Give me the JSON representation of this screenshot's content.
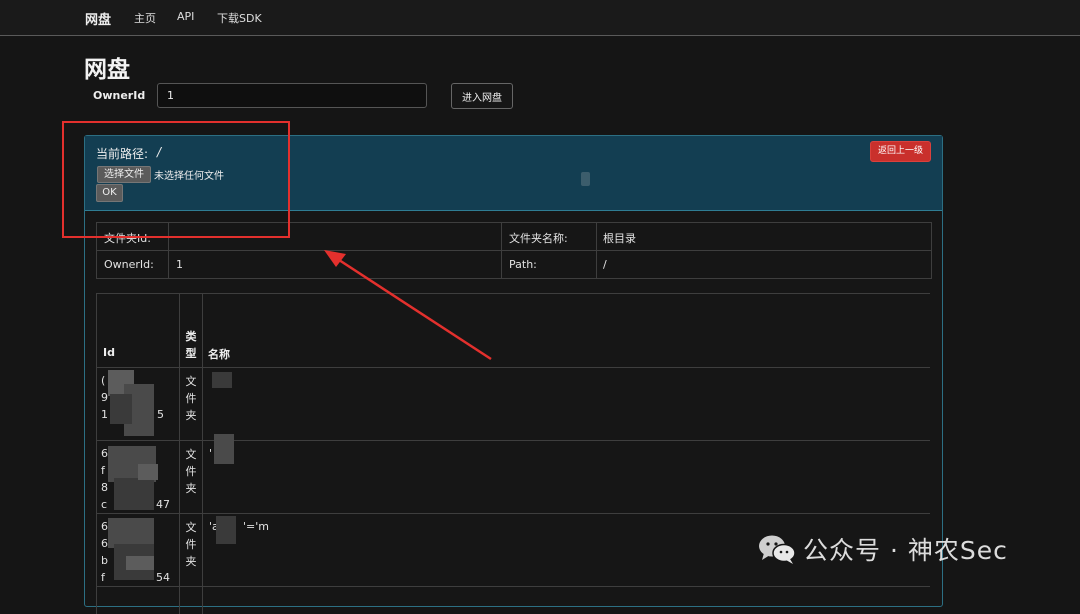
{
  "navbar": {
    "brand": "网盘",
    "links": [
      "主页",
      "API",
      "下载SDK"
    ]
  },
  "page": {
    "title": "网盘"
  },
  "owner_form": {
    "label": "OwnerId",
    "value": "1",
    "submit_label": "进入网盘"
  },
  "panel": {
    "path_label": "当前路径:",
    "path_value": "/",
    "choose_file_label": "选择文件",
    "no_file_text": "未选择任何文件",
    "ok_label": "OK",
    "back_label": "返回上一级"
  },
  "info": {
    "folder_id_label": "文件夹Id:",
    "folder_id_value": "",
    "folder_name_label": "文件夹名称:",
    "folder_name_value": "根目录",
    "owner_label": "OwnerId:",
    "owner_value": "1",
    "path_label": "Path:",
    "path_value": "/"
  },
  "list": {
    "headers": {
      "id": "Id",
      "type": "类型",
      "name": "名称"
    },
    "rows": [
      {
        "id_fragments": [
          "(",
          "9",
          "1",
          "5"
        ],
        "type": "文件夹",
        "name": ""
      },
      {
        "id_fragments": [
          "6",
          "f",
          "8",
          "c",
          "47"
        ],
        "type": "文件夹",
        "name": "'"
      },
      {
        "id_fragments": [
          "6",
          "6",
          "b",
          "f",
          "54"
        ],
        "type": "文件夹",
        "name": "'a",
        "name_tail": "'='m"
      }
    ]
  },
  "watermark": {
    "text": "公众号 · 神农Sec"
  },
  "colors": {
    "background": "#151515",
    "panel_header": "#133e52",
    "panel_border": "#2c6f83",
    "danger_button": "#c9302c",
    "annotation_red": "#e3302d"
  }
}
